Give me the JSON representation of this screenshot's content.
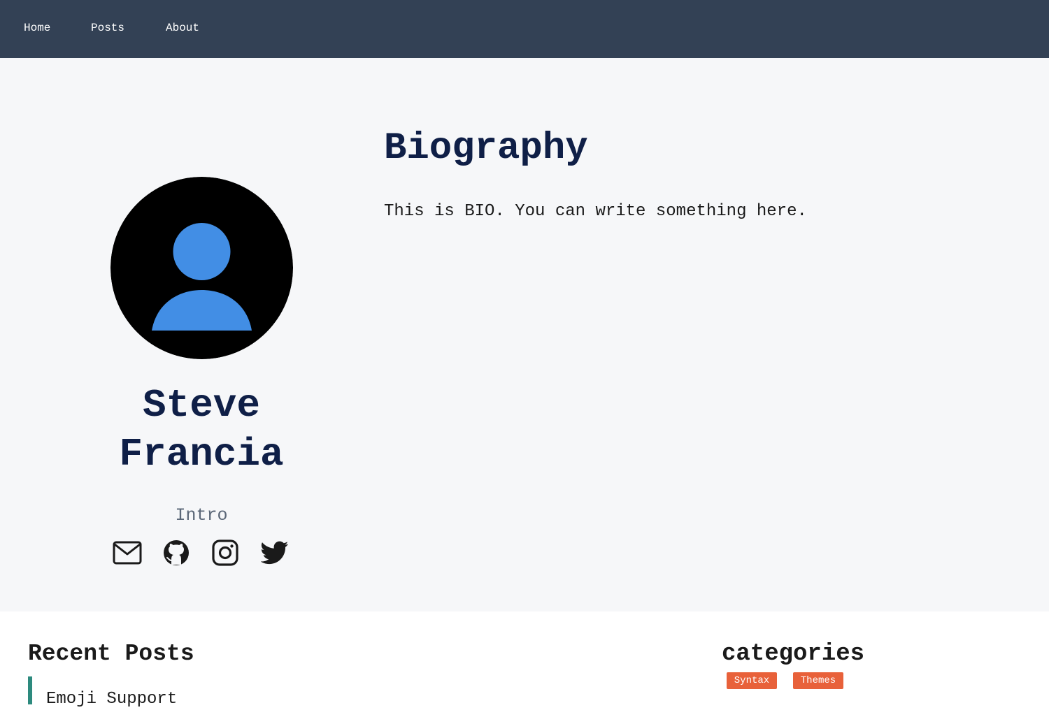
{
  "nav": {
    "items": [
      {
        "label": "Home"
      },
      {
        "label": "Posts"
      },
      {
        "label": "About"
      }
    ]
  },
  "profile": {
    "name": "Steve Francia",
    "intro": "Intro",
    "social": [
      "email-icon",
      "github-icon",
      "instagram-icon",
      "twitter-icon"
    ]
  },
  "bio": {
    "title": "Biography",
    "text": "This is BIO. You can write something here."
  },
  "recent": {
    "title": "Recent Posts",
    "first_post": "Emoji Support"
  },
  "categories": {
    "title": "categories",
    "tags": [
      {
        "label": "Syntax"
      },
      {
        "label": "Themes"
      }
    ]
  },
  "colors": {
    "nav_bg": "#334155",
    "heading": "#0f1f47",
    "avatar_figure": "#428ee5",
    "tag_bg": "#e8613a",
    "accent_bar": "#2d8a7e"
  }
}
